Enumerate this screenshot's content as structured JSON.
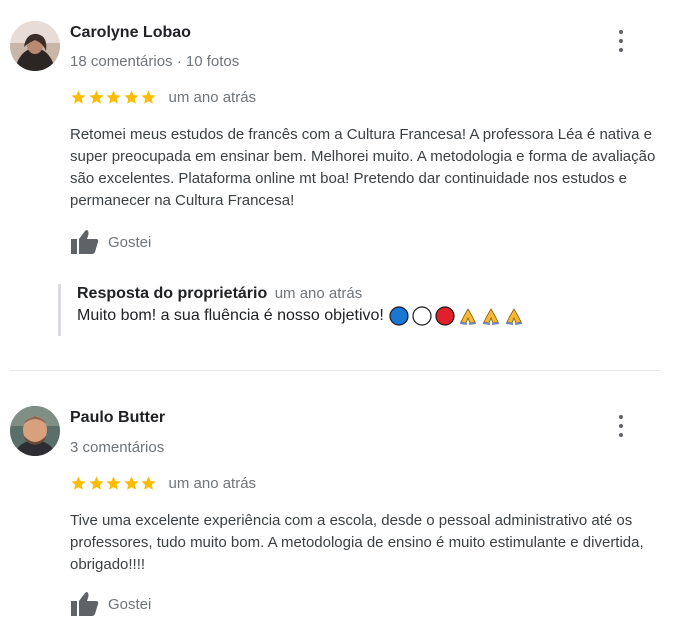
{
  "reviews": [
    {
      "author": "Carolyne Lobao",
      "stats": "18 comentários · 10 fotos",
      "rating": 5,
      "time": "um ano atrás",
      "text": "Retomei meus estudos de francês com a Cultura Francesa! A professora Léa é nativa e super preocupada em ensinar bem. Melhorei muito. A metodologia e forma de avaliação são excelentes. Plataforma online mt boa! Pretendo dar continuidade nos estudos e permanecer na Cultura Francesa!",
      "like_label": "Gostei",
      "owner_response": {
        "label": "Resposta do proprietário",
        "time": "um ano atrás",
        "text": "Muito bom! a sua fluência é nosso objetivo!",
        "emojis": [
          "blue-circle",
          "white-circle",
          "red-circle",
          "folded-hands",
          "folded-hands",
          "folded-hands"
        ]
      }
    },
    {
      "author": "Paulo Butter",
      "stats": "3 comentários",
      "rating": 5,
      "time": "um ano atrás",
      "text": "Tive uma excelente experiência com a escola, desde o pessoal administrativo até os professores, tudo muito bom. A metodologia de ensino é muito estimulante e divertida, obrigado!!!!",
      "like_label": "Gostei"
    }
  ],
  "colors": {
    "star": "#fbbc04",
    "muted_text": "#70757a",
    "body_text": "#3c4043",
    "name_text": "#202124",
    "thumb": "#5f6368",
    "reply_bar": "#dadce0"
  }
}
